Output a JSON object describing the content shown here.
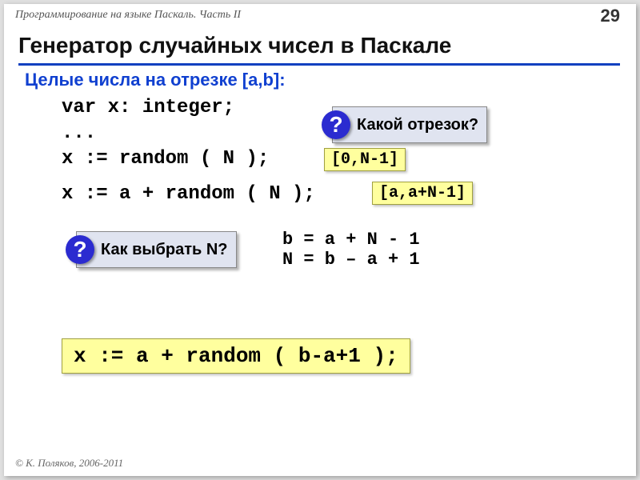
{
  "header": {
    "course": "Программирование на языке Паскаль. Часть II",
    "page": "29"
  },
  "title": "Генератор случайных чисел в Паскале",
  "subtitle": "Целые числа на отрезке [a,b]:",
  "code": {
    "line1": "var x: integer;",
    "line2": "...",
    "line3": "x := random ( N );",
    "line4": "x := a + random ( N );"
  },
  "callouts": {
    "q_mark": "?",
    "q1": "Какой отрезок?",
    "q2": "Как выбрать N?"
  },
  "ybox": {
    "r1": "[0,N-1]",
    "r2": "[a,a+N-1]",
    "final": "x := a + random ( b-a+1 );"
  },
  "equations": "b = a + N - 1\nN = b – a + 1",
  "footer": "© К. Поляков, 2006-2011"
}
